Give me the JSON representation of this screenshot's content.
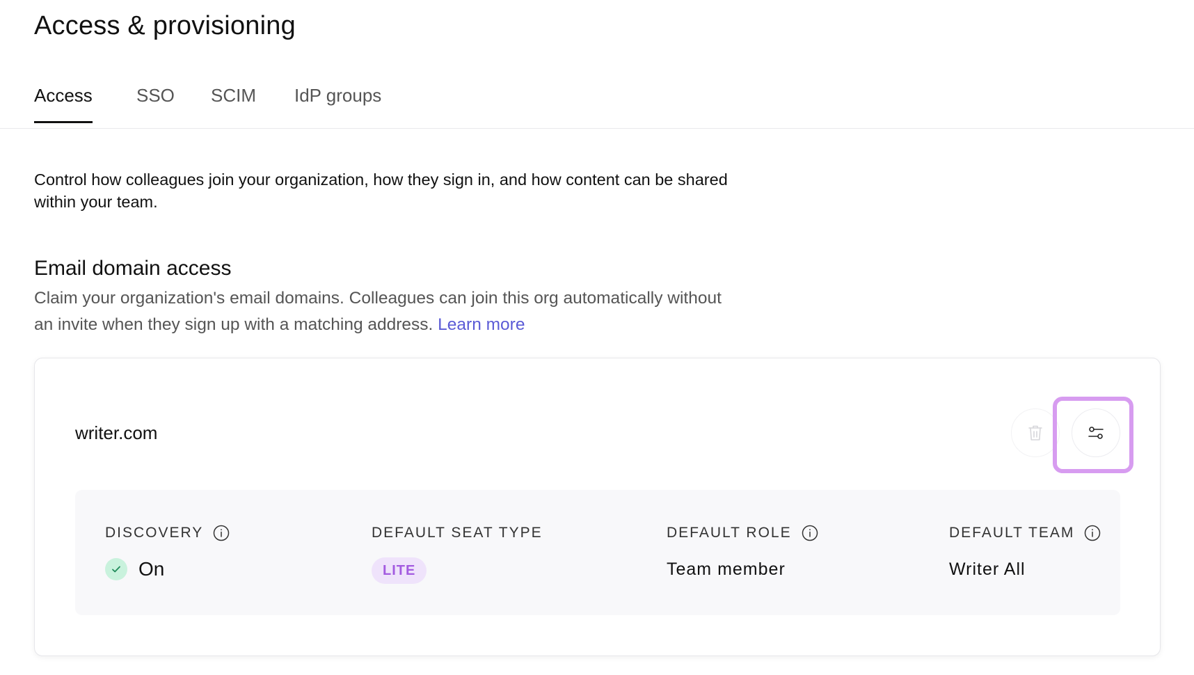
{
  "page": {
    "title": "Access & provisioning"
  },
  "tabs": [
    {
      "label": "Access",
      "active": true
    },
    {
      "label": "SSO",
      "active": false
    },
    {
      "label": "SCIM",
      "active": false
    },
    {
      "label": "IdP groups",
      "active": false
    }
  ],
  "intro": "Control how colleagues join your organization, how they sign in, and how content can be shared within your team.",
  "email_domain": {
    "title": "Email domain access",
    "description": "Claim your organization's email domains. Colleagues can join this org automatically without an invite when they sign up with a matching address.",
    "learn_more": "Learn more",
    "domain": {
      "name": "writer.com",
      "delete_icon": "trash-icon",
      "settings_icon": "sliders-icon",
      "columns": {
        "discovery": {
          "label": "DISCOVERY",
          "value": "On",
          "status_color": "#c9f2dd"
        },
        "seat_type": {
          "label": "DEFAULT SEAT TYPE",
          "value": "LITE",
          "badge_color": "#efe3fb"
        },
        "role": {
          "label": "DEFAULT ROLE",
          "value": "Team member"
        },
        "team": {
          "label": "DEFAULT TEAM",
          "value": "Writer All"
        }
      }
    }
  },
  "colors": {
    "accent": "#5b5bd6",
    "highlight": "#d79cf0"
  }
}
